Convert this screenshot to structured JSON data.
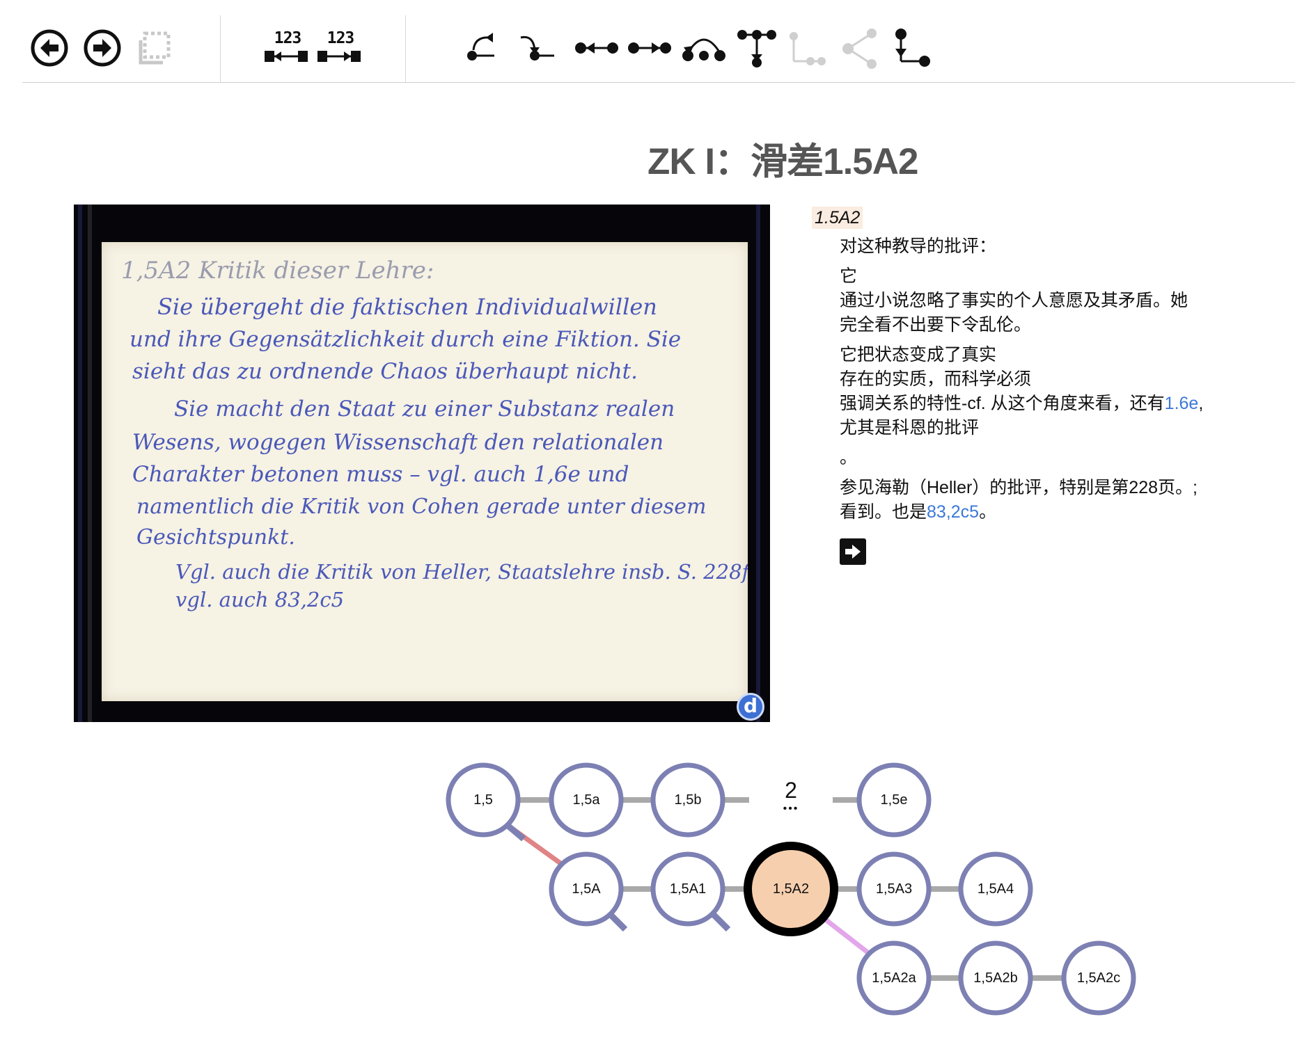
{
  "toolbar": {
    "left_group": [
      {
        "name": "back-button",
        "icon": "arrow-left-circle-icon"
      },
      {
        "name": "forward-button",
        "icon": "arrow-right-circle-icon"
      },
      {
        "name": "copy-button",
        "icon": "copy-icon",
        "disabled": true
      }
    ],
    "number_buttons": [
      {
        "label": "123",
        "icon": "number-left-arrow-icon"
      },
      {
        "label": "123",
        "icon": "number-right-arrow-icon"
      }
    ],
    "nav_icons": [
      "prev-branch-icon",
      "next-branch-icon",
      "prev-card-icon",
      "next-card-icon",
      "sibling-loop-icon",
      "parent-child-icon",
      "child-disabled-icon",
      "share-disabled-icon",
      "go-child-icon"
    ]
  },
  "title": "ZK I：滑差1.5A2",
  "scan": {
    "badge": "d",
    "handwriting": [
      "1,5A2   Kritik dieser Lehre:",
      "Sie übergeht die faktischen Individualwillen",
      "und ihre Gegensätzlichkeit durch eine Fiktion. Sie",
      "sieht das zu ordnende Chaos überhaupt nicht.",
      "Sie macht den Staat zu einer Substanz realen",
      "Wesens, wogegen Wissenschaft den relationalen",
      "Charakter betonen muss – vgl. auch 1,6e und",
      "namentlich die Kritik von Cohen gerade unter diesem",
      "Gesichtspunkt.",
      "Vgl. auch die Kritik von Heller, Staatslehre insb. S. 228f.",
      "vgl. auch 83,2c5"
    ]
  },
  "note": {
    "id": "1.5A2",
    "heading": "对这种教导的批评：",
    "p1_lines": [
      "它",
      "通过小说忽略了事实的个人意愿及其矛盾。她",
      "完全看不出要下令乱伦。"
    ],
    "p2_line1": "它把状态变成了真实",
    "p2_line2": "存在的实质，而科学必须",
    "p2_line3_pre": "强调关系的特性-cf. 从这个角度来看，还有",
    "p2_link": "1.6e",
    "p2_line3_post": ",",
    "p2_line4": "尤其是科恩的批评",
    "p3": "。",
    "p4_line1": "参见海勒（Heller）的批评，特别是第228页。;",
    "p4_line2_pre": "看到。也是",
    "p4_link": "83,2c5",
    "p4_line2_post": "。",
    "next_icon": "arrow-right-box-icon"
  },
  "graph": {
    "colors": {
      "node_border": "#7d80b3",
      "current_fill": "#f6cfae",
      "current_border": "#000000",
      "edge": "#a9a9a9",
      "parent_edge": "#e08486",
      "child_edge": "#e3a6ea"
    },
    "row1": [
      "1,5",
      "1,5a",
      "1,5b",
      "1,5e"
    ],
    "row1_gap_count": "2",
    "row1_gap_dots": "•••",
    "row2": [
      "1,5A",
      "1,5A1",
      "1,5A2",
      "1,5A3",
      "1,5A4"
    ],
    "row3": [
      "1,5A2a",
      "1,5A2b",
      "1,5A2c"
    ],
    "current": "1,5A2"
  }
}
